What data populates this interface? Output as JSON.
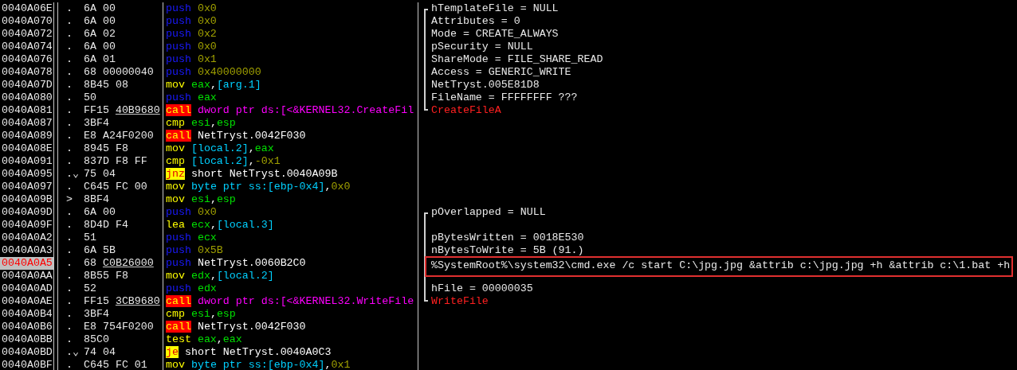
{
  "rows": [
    {
      "address": "0040A06E",
      "selected": false,
      "marker": ".",
      "hex": [
        {
          "text": "6A 00",
          "underlined": false
        }
      ],
      "mnemonic": "push",
      "kind": "push",
      "operands": [
        {
          "text": "0x0",
          "kind": "const"
        }
      ],
      "comment": {
        "text": "hTemplateFile = NULL",
        "kind": "arg",
        "opens": true,
        "closes": false
      }
    },
    {
      "address": "0040A070",
      "selected": false,
      "marker": ".",
      "hex": [
        {
          "text": "6A 00",
          "underlined": false
        }
      ],
      "mnemonic": "push",
      "kind": "push",
      "operands": [
        {
          "text": "0x0",
          "kind": "const"
        }
      ],
      "comment": {
        "text": "Attributes = 0",
        "kind": "arg",
        "opens": false,
        "closes": false
      }
    },
    {
      "address": "0040A072",
      "selected": false,
      "marker": ".",
      "hex": [
        {
          "text": "6A 02",
          "underlined": false
        }
      ],
      "mnemonic": "push",
      "kind": "push",
      "operands": [
        {
          "text": "0x2",
          "kind": "const"
        }
      ],
      "comment": {
        "text": "Mode = CREATE_ALWAYS",
        "kind": "arg",
        "opens": false,
        "closes": false
      }
    },
    {
      "address": "0040A074",
      "selected": false,
      "marker": ".",
      "hex": [
        {
          "text": "6A 00",
          "underlined": false
        }
      ],
      "mnemonic": "push",
      "kind": "push",
      "operands": [
        {
          "text": "0x0",
          "kind": "const"
        }
      ],
      "comment": {
        "text": "pSecurity = NULL",
        "kind": "arg",
        "opens": false,
        "closes": false
      }
    },
    {
      "address": "0040A076",
      "selected": false,
      "marker": ".",
      "hex": [
        {
          "text": "6A 01",
          "underlined": false
        }
      ],
      "mnemonic": "push",
      "kind": "push",
      "operands": [
        {
          "text": "0x1",
          "kind": "const"
        }
      ],
      "comment": {
        "text": "ShareMode = FILE_SHARE_READ",
        "kind": "arg",
        "opens": false,
        "closes": false
      }
    },
    {
      "address": "0040A078",
      "selected": false,
      "marker": ".",
      "hex": [
        {
          "text": "68 00000040",
          "underlined": false
        }
      ],
      "mnemonic": "push",
      "kind": "push",
      "operands": [
        {
          "text": "0x40000000",
          "kind": "const"
        }
      ],
      "comment": {
        "text": "Access = GENERIC_WRITE",
        "kind": "arg",
        "opens": false,
        "closes": false
      }
    },
    {
      "address": "0040A07D",
      "selected": false,
      "marker": ".",
      "hex": [
        {
          "text": "8B45 08",
          "underlined": false
        }
      ],
      "mnemonic": "mov",
      "kind": "op",
      "operands": [
        {
          "text": "eax",
          "kind": "reg"
        },
        {
          "text": ",",
          "kind": "plain"
        },
        {
          "text": "[arg.1]",
          "kind": "mem"
        }
      ],
      "comment": {
        "text": "NetTryst.005E81D8",
        "kind": "arg",
        "opens": false,
        "closes": false
      }
    },
    {
      "address": "0040A080",
      "selected": false,
      "marker": ".",
      "hex": [
        {
          "text": "50",
          "underlined": false
        }
      ],
      "mnemonic": "push",
      "kind": "push",
      "operands": [
        {
          "text": "eax",
          "kind": "reg"
        }
      ],
      "comment": {
        "text": "FileName = FFFFFFFF ???",
        "kind": "arg",
        "opens": false,
        "closes": false
      }
    },
    {
      "address": "0040A081",
      "selected": false,
      "marker": ".",
      "hex": [
        {
          "text": "FF15 ",
          "underlined": false
        },
        {
          "text": "40B9680",
          "underlined": true
        }
      ],
      "mnemonic": "call",
      "kind": "call",
      "operands": [
        {
          "text": "dword ptr ds:[<&KERNEL32.CreateFil",
          "kind": "api"
        }
      ],
      "comment": {
        "text": "CreateFileA",
        "kind": "api",
        "opens": false,
        "closes": true
      }
    },
    {
      "address": "0040A087",
      "selected": false,
      "marker": ".",
      "hex": [
        {
          "text": "3BF4",
          "underlined": false
        }
      ],
      "mnemonic": "cmp",
      "kind": "op",
      "operands": [
        {
          "text": "esi",
          "kind": "reg"
        },
        {
          "text": ",",
          "kind": "plain"
        },
        {
          "text": "esp",
          "kind": "reg"
        }
      ]
    },
    {
      "address": "0040A089",
      "selected": false,
      "marker": ".",
      "hex": [
        {
          "text": "E8 A24F0200",
          "underlined": false
        }
      ],
      "mnemonic": "call",
      "kind": "call",
      "operands": [
        {
          "text": "NetTryst.0042F030",
          "kind": "sym"
        }
      ]
    },
    {
      "address": "0040A08E",
      "selected": false,
      "marker": ".",
      "hex": [
        {
          "text": "8945 F8",
          "underlined": false
        }
      ],
      "mnemonic": "mov",
      "kind": "op",
      "operands": [
        {
          "text": "[local.2]",
          "kind": "mem"
        },
        {
          "text": ",",
          "kind": "plain"
        },
        {
          "text": "eax",
          "kind": "reg"
        }
      ]
    },
    {
      "address": "0040A091",
      "selected": false,
      "marker": ".",
      "hex": [
        {
          "text": "837D F8 FF",
          "underlined": false
        }
      ],
      "mnemonic": "cmp",
      "kind": "op",
      "operands": [
        {
          "text": "[local.2]",
          "kind": "mem"
        },
        {
          "text": ",",
          "kind": "plain"
        },
        {
          "text": "-0x1",
          "kind": "const"
        }
      ]
    },
    {
      "address": "0040A095",
      "selected": false,
      "marker": ".⌄",
      "hex": [
        {
          "text": "75 04",
          "underlined": false
        }
      ],
      "mnemonic": "jnz",
      "kind": "jump",
      "operands": [
        {
          "text": "short NetTryst.0040A09B",
          "kind": "sym"
        }
      ]
    },
    {
      "address": "0040A097",
      "selected": false,
      "marker": ".",
      "hex": [
        {
          "text": "C645 FC 00",
          "underlined": false
        }
      ],
      "mnemonic": "mov",
      "kind": "op",
      "operands": [
        {
          "text": "byte ptr ss:[ebp-0x4]",
          "kind": "mem"
        },
        {
          "text": ",",
          "kind": "plain"
        },
        {
          "text": "0x0",
          "kind": "const"
        }
      ]
    },
    {
      "address": "0040A09B",
      "selected": false,
      "marker": ">",
      "hex": [
        {
          "text": "8BF4",
          "underlined": false
        }
      ],
      "mnemonic": "mov",
      "kind": "op",
      "operands": [
        {
          "text": "esi",
          "kind": "reg"
        },
        {
          "text": ",",
          "kind": "plain"
        },
        {
          "text": "esp",
          "kind": "reg"
        }
      ]
    },
    {
      "address": "0040A09D",
      "selected": false,
      "marker": ".",
      "hex": [
        {
          "text": "6A 00",
          "underlined": false
        }
      ],
      "mnemonic": "push",
      "kind": "push",
      "operands": [
        {
          "text": "0x0",
          "kind": "const"
        }
      ],
      "comment": {
        "text": "pOverlapped = NULL",
        "kind": "arg",
        "opens": true,
        "closes": false
      }
    },
    {
      "address": "0040A09F",
      "selected": false,
      "marker": ".",
      "hex": [
        {
          "text": "8D4D F4",
          "underlined": false
        }
      ],
      "mnemonic": "lea",
      "kind": "op",
      "operands": [
        {
          "text": "ecx",
          "kind": "reg"
        },
        {
          "text": ",",
          "kind": "plain"
        },
        {
          "text": "[local.3]",
          "kind": "mem"
        }
      ],
      "comment": {
        "opens": false,
        "closes": false
      }
    },
    {
      "address": "0040A0A2",
      "selected": false,
      "marker": ".",
      "hex": [
        {
          "text": "51",
          "underlined": false
        }
      ],
      "mnemonic": "push",
      "kind": "push",
      "operands": [
        {
          "text": "ecx",
          "kind": "reg"
        }
      ],
      "comment": {
        "text": "pBytesWritten = 0018E530",
        "kind": "arg",
        "opens": false,
        "closes": false
      }
    },
    {
      "address": "0040A0A3",
      "selected": false,
      "marker": ".",
      "hex": [
        {
          "text": "6A 5B",
          "underlined": false
        }
      ],
      "mnemonic": "push",
      "kind": "push",
      "operands": [
        {
          "text": "0x5B",
          "kind": "const"
        }
      ],
      "comment": {
        "text": "nBytesToWrite = 5B (91.)",
        "kind": "arg",
        "opens": false,
        "closes": false
      }
    },
    {
      "address": "0040A0A5",
      "selected": true,
      "marker": ".",
      "hex": [
        {
          "text": "68 ",
          "underlined": false
        },
        {
          "text": "C0B26000",
          "underlined": true
        }
      ],
      "mnemonic": "push",
      "kind": "push",
      "operands": [
        {
          "text": "NetTryst.0060B2C0",
          "kind": "sym"
        }
      ],
      "comment": {
        "text": "%SystemRoot%\\system32\\cmd.exe /c start C:\\jpg.jpg &attrib c:\\jpg.jpg +h &attrib c:\\1.bat +h",
        "kind": "boxed",
        "opens": false,
        "closes": false
      }
    },
    {
      "address": "0040A0AA",
      "selected": false,
      "marker": ".",
      "hex": [
        {
          "text": "8B55 F8",
          "underlined": false
        }
      ],
      "mnemonic": "mov",
      "kind": "op",
      "operands": [
        {
          "text": "edx",
          "kind": "reg"
        },
        {
          "text": ",",
          "kind": "plain"
        },
        {
          "text": "[local.2]",
          "kind": "mem"
        }
      ],
      "comment": {
        "opens": false,
        "closes": false
      }
    },
    {
      "address": "0040A0AD",
      "selected": false,
      "marker": ".",
      "hex": [
        {
          "text": "52",
          "underlined": false
        }
      ],
      "mnemonic": "push",
      "kind": "push",
      "operands": [
        {
          "text": "edx",
          "kind": "reg"
        }
      ],
      "comment": {
        "text": "hFile = 00000035",
        "kind": "arg",
        "opens": false,
        "closes": false
      }
    },
    {
      "address": "0040A0AE",
      "selected": false,
      "marker": ".",
      "hex": [
        {
          "text": "FF15 ",
          "underlined": false
        },
        {
          "text": "3CB9680",
          "underlined": true
        }
      ],
      "mnemonic": "call",
      "kind": "call",
      "operands": [
        {
          "text": "dword ptr ds:[<&KERNEL32.WriteFile",
          "kind": "api"
        }
      ],
      "comment": {
        "text": "WriteFile",
        "kind": "api",
        "opens": false,
        "closes": true
      }
    },
    {
      "address": "0040A0B4",
      "selected": false,
      "marker": ".",
      "hex": [
        {
          "text": "3BF4",
          "underlined": false
        }
      ],
      "mnemonic": "cmp",
      "kind": "op",
      "operands": [
        {
          "text": "esi",
          "kind": "reg"
        },
        {
          "text": ",",
          "kind": "plain"
        },
        {
          "text": "esp",
          "kind": "reg"
        }
      ]
    },
    {
      "address": "0040A0B6",
      "selected": false,
      "marker": ".",
      "hex": [
        {
          "text": "E8 754F0200",
          "underlined": false
        }
      ],
      "mnemonic": "call",
      "kind": "call",
      "operands": [
        {
          "text": "NetTryst.0042F030",
          "kind": "sym"
        }
      ]
    },
    {
      "address": "0040A0BB",
      "selected": false,
      "marker": ".",
      "hex": [
        {
          "text": "85C0",
          "underlined": false
        }
      ],
      "mnemonic": "test",
      "kind": "op",
      "operands": [
        {
          "text": "eax",
          "kind": "reg"
        },
        {
          "text": ",",
          "kind": "plain"
        },
        {
          "text": "eax",
          "kind": "reg"
        }
      ]
    },
    {
      "address": "0040A0BD",
      "selected": false,
      "marker": ".⌄",
      "hex": [
        {
          "text": "74 04",
          "underlined": false
        }
      ],
      "mnemonic": "je",
      "kind": "jump",
      "operands": [
        {
          "text": "short NetTryst.0040A0C3",
          "kind": "sym"
        }
      ]
    },
    {
      "address": "0040A0BF",
      "selected": false,
      "marker": ".",
      "hex": [
        {
          "text": "C645 FC 01",
          "underlined": false
        }
      ],
      "mnemonic": "mov",
      "kind": "op",
      "operands": [
        {
          "text": "byte ptr ss:[ebp-0x4]",
          "kind": "mem"
        },
        {
          "text": ",",
          "kind": "plain"
        },
        {
          "text": "0x1",
          "kind": "const"
        }
      ]
    }
  ]
}
